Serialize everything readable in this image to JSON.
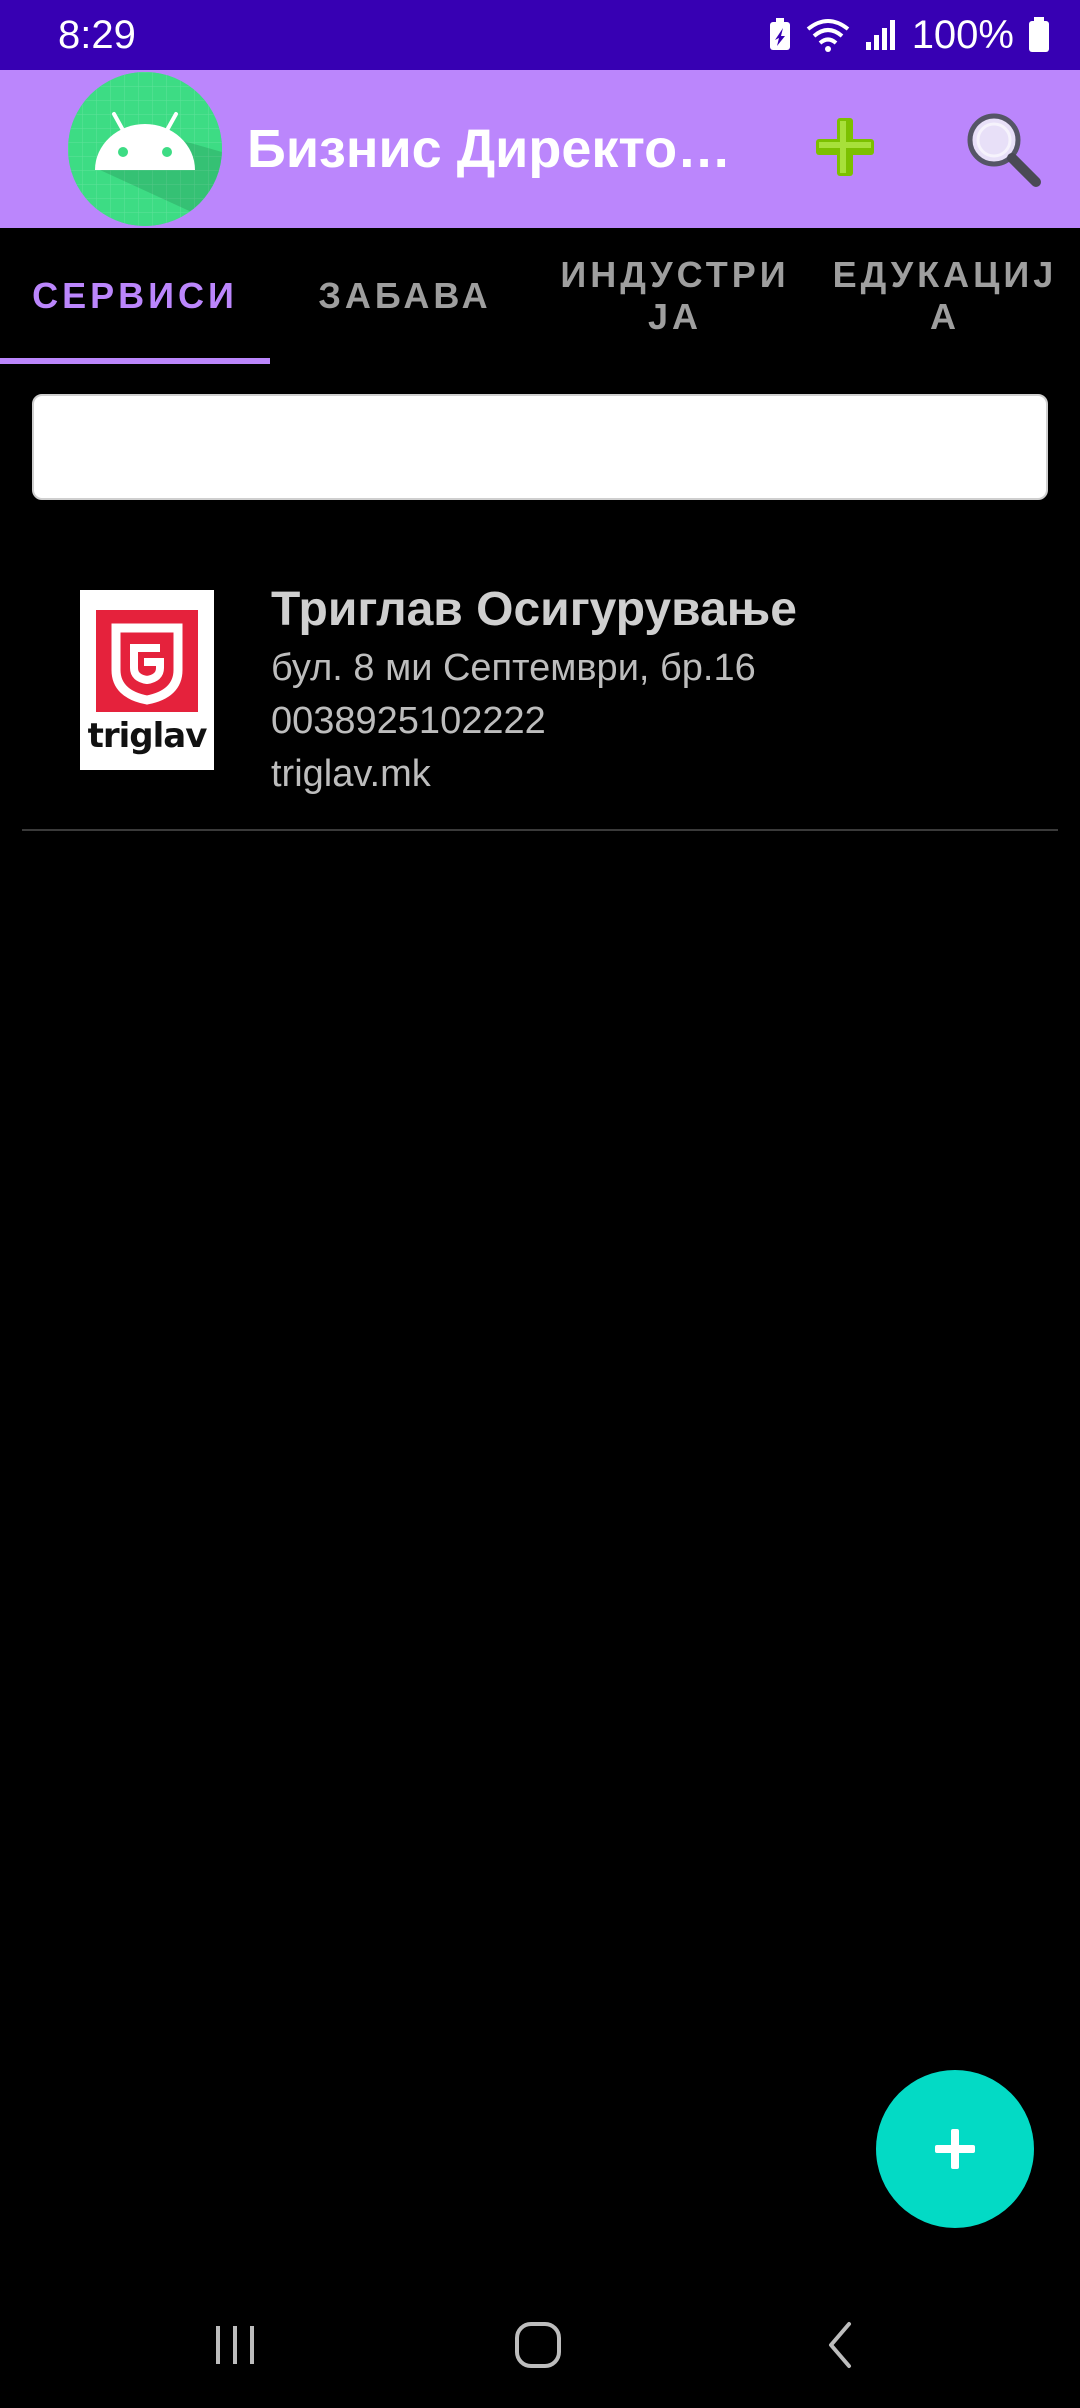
{
  "status_bar": {
    "time": "8:29",
    "battery_text": "100%",
    "icons": [
      "battery-saver-icon",
      "wifi-icon",
      "signal-icon",
      "battery-icon"
    ]
  },
  "app_bar": {
    "title": "Бизнис Директо…",
    "logo_icon": "android-logo-icon",
    "add_icon": "plus-icon",
    "search_icon": "search-icon",
    "colors": {
      "background": "#bb86fc",
      "add": "#7cc000"
    }
  },
  "tabs": [
    {
      "label": "СЕРВИСИ",
      "active": true
    },
    {
      "label": "ЗАБАВА",
      "active": false
    },
    {
      "label": "ИНДУСТРИЈА",
      "active": false
    },
    {
      "label": "ЕДУКАЦИЈА",
      "active": false
    }
  ],
  "search": {
    "value": "",
    "placeholder": ""
  },
  "list": {
    "items": [
      {
        "logo_text": "triglav",
        "name": "Триглав Осигурување",
        "address": "бул. 8 ми Септември, бр.16",
        "phone": "0038925102222",
        "website": "triglav.mk"
      }
    ]
  },
  "fab": {
    "icon": "plus-icon",
    "color": "#03dac5"
  },
  "nav_bar": {
    "icons": [
      "recents-icon",
      "home-icon",
      "back-icon"
    ]
  },
  "colors": {
    "status_bar": "#3700b3",
    "accent": "#bb86fc",
    "background": "#000000"
  }
}
